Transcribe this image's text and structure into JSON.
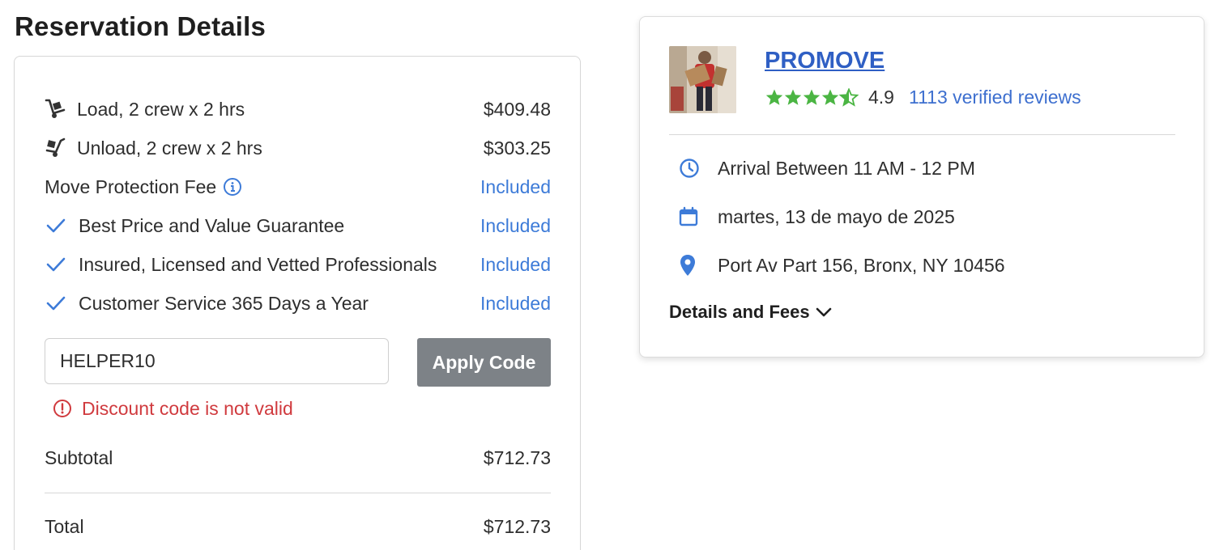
{
  "page": {
    "title": "Reservation Details"
  },
  "reservation": {
    "line_items": [
      {
        "icon": "dolly-load-icon",
        "label": "Load, 2 crew x 2 hrs",
        "amount": "$409.48"
      },
      {
        "icon": "dolly-unload-icon",
        "label": "Unload, 2 crew x 2 hrs",
        "amount": "$303.25"
      }
    ],
    "protection_fee": {
      "label": "Move Protection Fee",
      "info_icon": "info-icon",
      "amount": "Included"
    },
    "guarantees": [
      {
        "icon": "check-icon",
        "label": "Best Price and Value Guarantee",
        "amount": "Included"
      },
      {
        "icon": "check-icon",
        "label": "Insured, Licensed and Vetted Professionals",
        "amount": "Included"
      },
      {
        "icon": "check-icon",
        "label": "Customer Service 365 Days a Year",
        "amount": "Included"
      }
    ],
    "discount": {
      "code_value": "HELPER10",
      "apply_label": "Apply Code",
      "error": "Discount code is not valid"
    },
    "subtotal": {
      "label": "Subtotal",
      "amount": "$712.73"
    },
    "total": {
      "label": "Total",
      "amount": "$712.73"
    }
  },
  "provider": {
    "name": "PROMOVE",
    "rating": "4.9",
    "stars": 4.5,
    "reviews": "1113 verified reviews",
    "arrival": "Arrival Between 11 AM - 12 PM",
    "date": "martes, 13 de mayo de 2025",
    "address": "Port Av Part 156, Bronx, NY 10456",
    "details_toggle": "Details and Fees"
  },
  "colors": {
    "included": "#3d7bd8",
    "error": "#d03a3e",
    "star": "#4bb543",
    "link": "#2f5fc4",
    "button_bg": "#7d8287"
  }
}
